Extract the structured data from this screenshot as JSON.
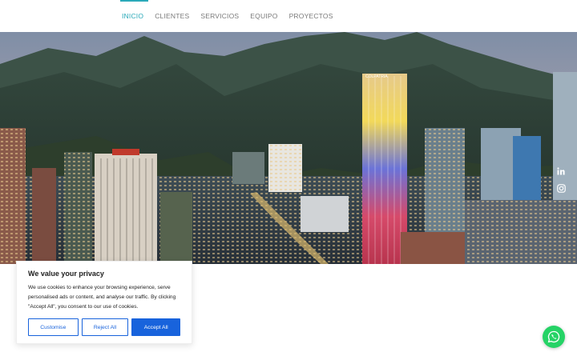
{
  "nav": {
    "items": [
      {
        "label": "INICIO",
        "active": true
      },
      {
        "label": "CLIENTES",
        "active": false
      },
      {
        "label": "SERVICIOS",
        "active": false
      },
      {
        "label": "EQUIPO",
        "active": false
      },
      {
        "label": "PROYECTOS",
        "active": false
      }
    ]
  },
  "hero": {
    "image": "bogota-city-skyline-with-mountains",
    "tower_sign": "COLPATRIA"
  },
  "social": {
    "icons": [
      "linkedin-icon",
      "instagram-icon"
    ]
  },
  "cookie_banner": {
    "title": "We value your privacy",
    "text": "We use cookies to enhance your browsing experience, serve personalised ads or content, and analyse our traffic. By clicking \"Accept All\", you consent to our use of cookies.",
    "buttons": {
      "customise": "Customise",
      "reject": "Reject All",
      "accept": "Accept All"
    }
  },
  "whatsapp": {
    "icon": "whatsapp-icon"
  },
  "colors": {
    "accent": "#2aa9b9",
    "nav_text": "#7a7a7a",
    "button_blue": "#1863dc",
    "whatsapp_green": "#25d366"
  }
}
